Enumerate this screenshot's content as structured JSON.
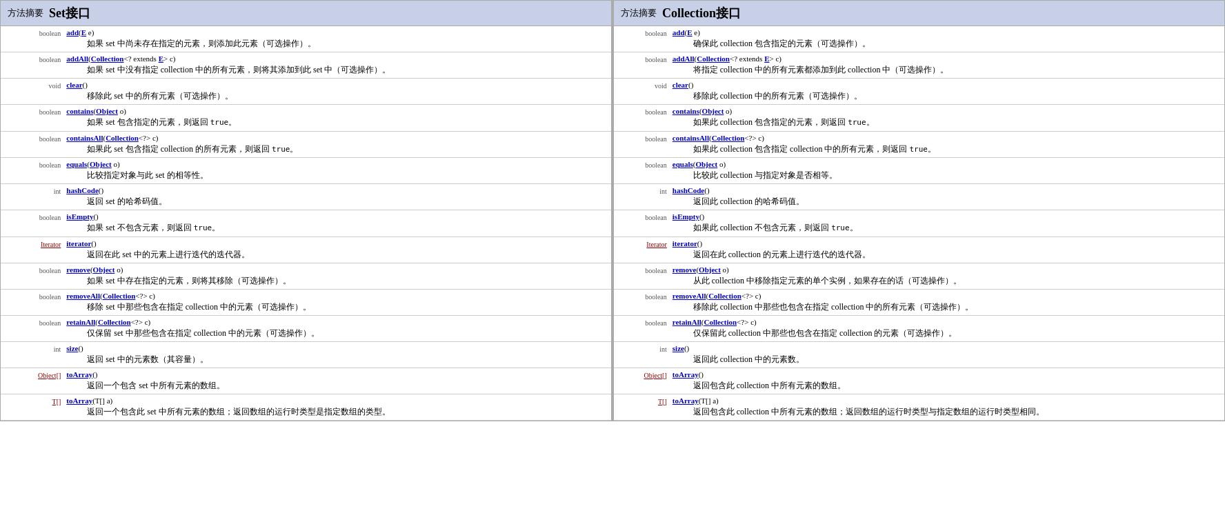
{
  "left": {
    "header": {
      "label": "方法摘要",
      "title": "Set接口"
    },
    "rows": [
      {
        "returnType": "boolean",
        "returnTypeLink": false,
        "sig": "add(<a class='param'>E</a> e)",
        "desc": "如果 set 中尚未存在指定的元素，则添加此元素（可选操作）。"
      },
      {
        "returnType": "boolean",
        "returnTypeLink": false,
        "sig": "addAll(<a>Collection</a>&lt;? extends <a class='param'>E</a>&gt; c)",
        "desc": "如果 set 中没有指定 collection 中的所有元素，则将其添加到此 set 中（可选操作）。"
      },
      {
        "returnType": "void",
        "returnTypeLink": false,
        "sig": "clear()",
        "desc": "移除此 set 中的所有元素（可选操作）。"
      },
      {
        "returnType": "boolean",
        "returnTypeLink": false,
        "sig": "contains(<a>Object</a> o)",
        "desc": "如果 set 包含指定的元素，则返回 true。"
      },
      {
        "returnType": "boolean",
        "returnTypeLink": false,
        "sig": "containsAll(<a>Collection</a>&lt;?&gt; c)",
        "desc": "如果此 set 包含指定 collection 的所有元素，则返回 true。"
      },
      {
        "returnType": "boolean",
        "returnTypeLink": false,
        "sig": "equals(<a>Object</a> o)",
        "desc": "比较指定对象与此 set 的相等性。"
      },
      {
        "returnType": "int",
        "returnTypeLink": false,
        "sig": "hashCode()",
        "desc": "返回 set 的哈希码值。"
      },
      {
        "returnType": "boolean",
        "returnTypeLink": false,
        "sig": "isEmpty()",
        "desc": "如果 set 不包含元素，则返回 true。"
      },
      {
        "returnType": "Iterator<E>",
        "returnTypeLink": true,
        "sig": "iterator()",
        "desc": "返回在此 set 中的元素上进行迭代的迭代器。"
      },
      {
        "returnType": "boolean",
        "returnTypeLink": false,
        "sig": "remove(<a>Object</a> o)",
        "desc": "如果 set 中存在指定的元素，则将其移除（可选操作）。"
      },
      {
        "returnType": "boolean",
        "returnTypeLink": false,
        "sig": "removeAll(<a>Collection</a>&lt;?&gt; c)",
        "desc": "移除 set 中那些包含在指定 collection 中的元素（可选操作）。"
      },
      {
        "returnType": "boolean",
        "returnTypeLink": false,
        "sig": "retainAll(<a>Collection</a>&lt;?&gt; c)",
        "desc": "仅保留 set 中那些包含在指定 collection 中的元素（可选操作）。"
      },
      {
        "returnType": "int",
        "returnTypeLink": false,
        "sig": "size()",
        "desc": "返回 set 中的元素数（其容量）。"
      },
      {
        "returnType": "Object[]",
        "returnTypeLink": true,
        "sig": "toArray()",
        "desc": "返回一个包含 set 中所有元素的数组。"
      },
      {
        "returnType": "<T> T[]",
        "returnTypeLink": true,
        "sig": "toArray(T[] a)",
        "desc": "返回一个包含此 set 中所有元素的数组；返回数组的运行时类型是指定数组的类型。"
      }
    ]
  },
  "right": {
    "header": {
      "label": "方法摘要",
      "title": "Collection接口"
    },
    "rows": [
      {
        "returnType": "boolean",
        "returnTypeLink": false,
        "sig": "add(<a class='param'>E</a> e)",
        "desc": "确保此 collection 包含指定的元素（可选操作）。"
      },
      {
        "returnType": "boolean",
        "returnTypeLink": false,
        "sig": "addAll(<a>Collection</a>&lt;? extends <a class='param'>E</a>&gt; c)",
        "desc": "将指定 collection 中的所有元素都添加到此 collection 中（可选操作）。"
      },
      {
        "returnType": "void",
        "returnTypeLink": false,
        "sig": "clear()",
        "desc": "移除此 collection 中的所有元素（可选操作）。"
      },
      {
        "returnType": "boolean",
        "returnTypeLink": false,
        "sig": "contains(<a>Object</a> o)",
        "desc": "如果此 collection 包含指定的元素，则返回 true。"
      },
      {
        "returnType": "boolean",
        "returnTypeLink": false,
        "sig": "containsAll(<a>Collection</a>&lt;?&gt; c)",
        "desc": "如果此 collection 包含指定 collection 中的所有元素，则返回 true。"
      },
      {
        "returnType": "boolean",
        "returnTypeLink": false,
        "sig": "equals(<a>Object</a> o)",
        "desc": "比较此 collection 与指定对象是否相等。"
      },
      {
        "returnType": "int",
        "returnTypeLink": false,
        "sig": "hashCode()",
        "desc": "返回此 collection 的哈希码值。"
      },
      {
        "returnType": "boolean",
        "returnTypeLink": false,
        "sig": "isEmpty()",
        "desc": "如果此 collection 不包含元素，则返回 true。"
      },
      {
        "returnType": "Iterator<E>",
        "returnTypeLink": true,
        "sig": "iterator()",
        "desc": "返回在此 collection 的元素上进行迭代的迭代器。"
      },
      {
        "returnType": "boolean",
        "returnTypeLink": false,
        "sig": "remove(<a>Object</a> o)",
        "desc": "从此 collection 中移除指定元素的单个实例，如果存在的话（可选操作）。"
      },
      {
        "returnType": "boolean",
        "returnTypeLink": false,
        "sig": "removeAll(<a>Collection</a>&lt;?&gt; c)",
        "desc": "移除此 collection 中那些也包含在指定 collection 中的所有元素（可选操作）。"
      },
      {
        "returnType": "boolean",
        "returnTypeLink": false,
        "sig": "retainAll(<a>Collection</a>&lt;?&gt; c)",
        "desc": "仅保留此 collection 中那些也包含在指定 collection 的元素（可选操作）。"
      },
      {
        "returnType": "int",
        "returnTypeLink": false,
        "sig": "size()",
        "desc": "返回此 collection 中的元素数。"
      },
      {
        "returnType": "Object[]",
        "returnTypeLink": true,
        "sig": "toArray()",
        "desc": "返回包含此 collection 中所有元素的数组。"
      },
      {
        "returnType": "<T> T[]",
        "returnTypeLink": true,
        "sig": "toArray(T[] a)",
        "desc": "返回包含此 collection 中所有元素的数组；返回数组的运行时类型与指定数组的运行时类型相同。"
      }
    ]
  }
}
